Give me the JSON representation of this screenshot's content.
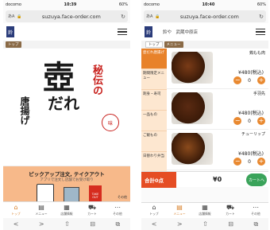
{
  "screen1": {
    "status": {
      "carrier": "docomo",
      "time": "10:39",
      "battery": "60%"
    },
    "url": "suzuya.face-order.com",
    "aa": "あA",
    "logo_char": "鈴",
    "crumb": "トップ",
    "hero": {
      "side": "唐揚げ",
      "big1": "壺",
      "big2": "だれ",
      "red": "秘伝の",
      "circle": "味"
    },
    "promo": {
      "title": "ピックアップ注文, テイクアウト",
      "sub": "アプリで注文し店舗でお受け取り",
      "bag_label": "TAKE OUT",
      "more": "その他"
    },
    "tabs": [
      {
        "label": "トップ",
        "icon": "⌂"
      },
      {
        "label": "メニュー",
        "icon": "▤"
      },
      {
        "label": "店舗情報",
        "icon": "▦"
      },
      {
        "label": "カート",
        "icon": "⛟"
      },
      {
        "label": "その他",
        "icon": "⋯"
      }
    ]
  },
  "screen2": {
    "status": {
      "carrier": "docomo",
      "time": "10:40",
      "battery": "60%"
    },
    "url": "suzuya.face-order.com",
    "aa": "あA",
    "logo_char": "鈴",
    "shop_name": "鈴や　武蔵中原店",
    "crumb": "トップ",
    "crumb2": "メニュー",
    "categories": [
      "壺だれ唐揚げ",
      "期間限定メニュー",
      "刺身・寿司",
      "一品もの",
      "ご飯もの",
      "日替わり弁当"
    ],
    "items": [
      {
        "name": "鶏もも肉",
        "price": "¥480(税込)",
        "qty": "0"
      },
      {
        "name": "手羽先",
        "price": "¥480(税込)",
        "qty": "0"
      },
      {
        "name": "チューリップ",
        "price": "¥480(税込)",
        "qty": "0"
      }
    ],
    "total_label": "合計0点",
    "total_value": "¥0",
    "cart_btn": "カートへ",
    "tabs": [
      {
        "label": "トップ",
        "icon": "⌂"
      },
      {
        "label": "メニュー",
        "icon": "▤"
      },
      {
        "label": "店舗情報",
        "icon": "▦"
      },
      {
        "label": "カート",
        "icon": "⛟"
      },
      {
        "label": "その他",
        "icon": "⋯"
      }
    ]
  },
  "browser_nav": [
    "<",
    ">",
    "⇧",
    "⊟",
    "⧉"
  ],
  "colors": {
    "accent": "#e98930",
    "promo": "#f7b98a",
    "category_bg": "#fde7d0",
    "total": "#e54d24",
    "cart_btn": "#3aa35a",
    "red_kanji": "#c8221e"
  }
}
